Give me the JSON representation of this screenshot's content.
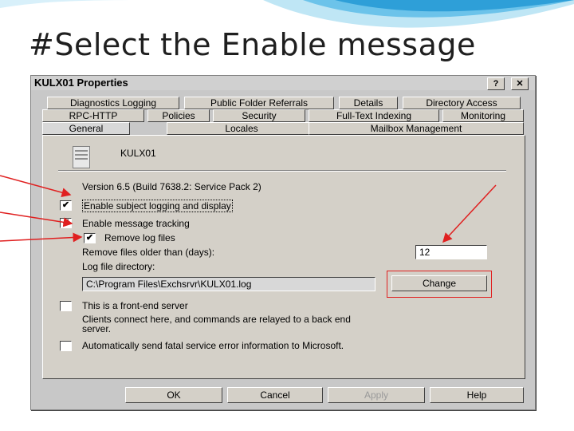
{
  "slide": {
    "title": "#Select the Enable message"
  },
  "dialog": {
    "title": "KULX01 Properties",
    "help_label": "?",
    "close_label": "✕",
    "tabs_row1": [
      "Diagnostics Logging",
      "Public Folder Referrals",
      "Details",
      "Directory Access"
    ],
    "tabs_row2": [
      "RPC-HTTP",
      "Policies",
      "Security",
      "Full-Text Indexing",
      "Monitoring"
    ],
    "tabs_row3": [
      "General",
      "Locales",
      "Mailbox Management"
    ],
    "server_name": "KULX01",
    "version": "Version 6.5 (Build 7638.2: Service Pack 2)",
    "options": {
      "subject_logging": {
        "label": "Enable subject logging and display",
        "checked": "✔"
      },
      "message_tracking": {
        "label": "Enable message tracking",
        "checked": "✔"
      },
      "remove_log_files": {
        "label": "Remove log files",
        "checked": "✔"
      },
      "remove_older_label": "Remove files older than (days):",
      "remove_older_value": "12",
      "log_dir_label": "Log file directory:",
      "log_dir_value": "C:\\Program Files\\Exchsrvr\\KULX01.log",
      "change_label": "Change",
      "front_end": {
        "label": "This is a front-end server",
        "checked": ""
      },
      "front_end_desc_1": "Clients connect here, and commands are relayed to a back end",
      "front_end_desc_2": "server.",
      "auto_send": {
        "label": "Automatically send fatal service error information to Microsoft.",
        "checked": ""
      }
    },
    "buttons": {
      "ok": "OK",
      "cancel": "Cancel",
      "apply": "Apply",
      "help": "Help"
    }
  },
  "colors": {
    "annotation": "#e02020",
    "wave": "#2e9fd8"
  }
}
